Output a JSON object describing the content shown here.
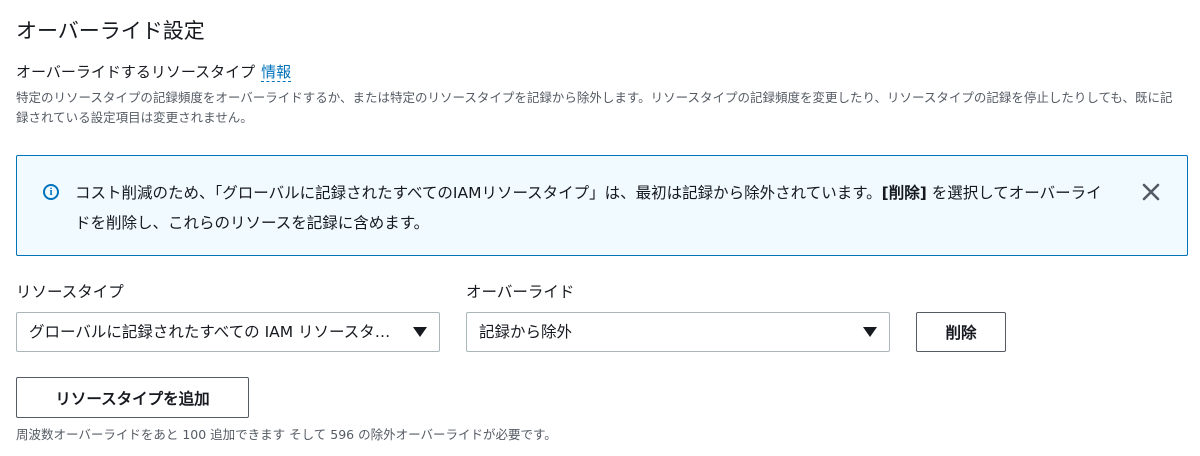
{
  "header": {
    "title": "オーバーライド設定"
  },
  "section": {
    "heading": "オーバーライドするリソースタイプ",
    "info_link": "情報",
    "description": "特定のリソースタイプの記録頻度をオーバーライドするか、または特定のリソースタイプを記録から除外します。リソースタイプの記録頻度を変更したり、リソースタイプの記録を停止したりしても、既に記録されている設定項目は変更されません。"
  },
  "alert": {
    "icon": "info-icon",
    "text_before": "コスト削減のため、「グローバルに記録されたすべてのIAMリソースタイプ」は、最初は記録から除外されています。",
    "text_bold": "[削除]",
    "text_after": " を選択してオーバーライドを削除し、これらのリソースを記録に含めます。",
    "close_icon": "close-icon"
  },
  "form": {
    "resource_type_label": "リソースタイプ",
    "resource_type_value": "グローバルに記録されたすべての IAM リソースタイプ",
    "override_label": "オーバーライド",
    "override_value": "記録から除外",
    "delete_button": "削除",
    "add_button": "リソースタイプを追加",
    "footer_note": "周波数オーバーライドをあと 100 追加できます そして 596 の除外オーバーライドが必要です。"
  },
  "colors": {
    "accent": "#0073bb",
    "alert_background": "#f1faff",
    "text": "#16191f",
    "secondary_text": "#545b64"
  }
}
